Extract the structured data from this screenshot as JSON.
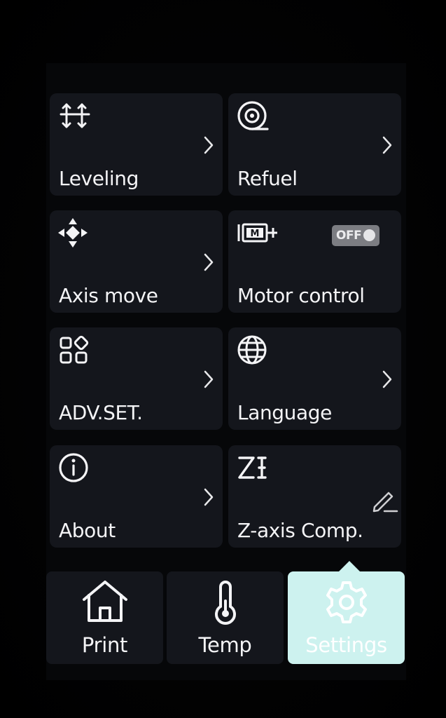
{
  "colors": {
    "background": "#000000",
    "tile": "#14161c",
    "text": "#f4f4f6",
    "toggle_off": "#7c7d82",
    "active_tab": "#cdf2ef"
  },
  "settings_grid": [
    {
      "label": "Leveling",
      "icon": "leveling-arrows-icon",
      "action": "chevron"
    },
    {
      "label": "Refuel",
      "icon": "filament-spool-icon",
      "action": "chevron"
    },
    {
      "label": "Axis move",
      "icon": "move-arrows-icon",
      "action": "chevron"
    },
    {
      "label": "Motor control",
      "icon": "motor-icon",
      "action": "toggle",
      "toggle_text": "OFF",
      "toggle_state": "off"
    },
    {
      "label": "ADV.SET.",
      "icon": "apps-grid-icon",
      "action": "chevron"
    },
    {
      "label": "Language",
      "icon": "globe-icon",
      "action": "chevron"
    },
    {
      "label": "About",
      "icon": "info-icon",
      "action": "chevron"
    },
    {
      "label": "Z-axis Comp.",
      "icon": "z-offset-icon",
      "action": "edit"
    }
  ],
  "bottom_nav": [
    {
      "label": "Print",
      "icon": "home-icon",
      "active": false
    },
    {
      "label": "Temp",
      "icon": "thermometer-icon",
      "active": false
    },
    {
      "label": "Settings",
      "icon": "gear-icon",
      "active": true
    }
  ]
}
